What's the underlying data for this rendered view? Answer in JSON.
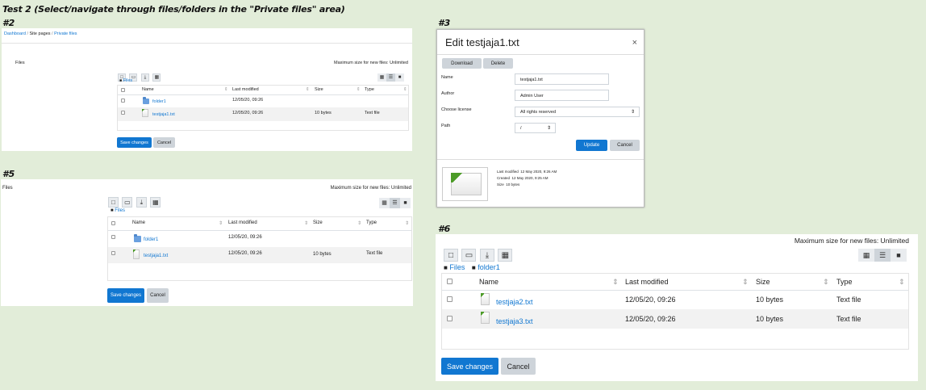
{
  "heading": "Test 2 (Select/navigate through files/folders in the \"Private files\" area)",
  "labels": {
    "s2": "#2",
    "s3": "#3",
    "s5": "#5",
    "s6": "#6"
  },
  "icons": {
    "new_file": "new-file-icon",
    "new_folder": "new-folder-icon",
    "download": "download-icon",
    "delete": "trash-icon",
    "view_icons": "grid-view-icon",
    "view_details": "list-view-icon",
    "view_tree": "tree-view-icon"
  },
  "colors": {
    "accent": "#1177d1",
    "background": "#e2edd9",
    "file_icon_green": "#4c9b27"
  },
  "s2": {
    "breadcrumb": {
      "dashboard": "Dashboard",
      "sep1": "/",
      "site_pages": "Site pages",
      "sep2": "/",
      "private_files": "Private files"
    },
    "files_label": "Files",
    "max_size": "Maximum size for new files: Unlimited",
    "path": {
      "root": "Files"
    },
    "columns": {
      "name": "Name",
      "modified": "Last modified",
      "size": "Size",
      "type": "Type"
    },
    "rows": [
      {
        "name": "folder1",
        "modified": "12/05/20, 09:26",
        "size": "",
        "type": ""
      },
      {
        "name": "testjaja1.txt",
        "modified": "12/05/20, 09:26",
        "size": "10 bytes",
        "type": "Text file"
      }
    ],
    "save": "Save changes",
    "cancel": "Cancel"
  },
  "s3": {
    "title": "Edit testjaja1.txt",
    "close": "×",
    "download": "Download",
    "delete": "Delete",
    "name_label": "Name",
    "name_value": "testjaja1.txt",
    "author_label": "Author",
    "author_value": "Admin User",
    "license_label": "Choose license",
    "license_value": "All rights reserved",
    "path_label": "Path",
    "path_value": "/",
    "update": "Update",
    "cancel": "Cancel",
    "info": {
      "last_modified_label": "Last modified",
      "last_modified": "12 May 2020, 9:26 AM",
      "created_label": "Created",
      "created": "12 May 2020, 9:25 AM",
      "size_label": "Size",
      "size": "10 bytes"
    }
  },
  "s5": {
    "files_label": "Files",
    "max_size": "Maximum size for new files: Unlimited",
    "path": {
      "root": "Files"
    },
    "columns": {
      "name": "Name",
      "modified": "Last modified",
      "size": "Size",
      "type": "Type"
    },
    "rows": [
      {
        "name": "folder1",
        "modified": "12/05/20, 09:26",
        "size": "",
        "type": ""
      },
      {
        "name": "testjaja1.txt",
        "modified": "12/05/20, 09:26",
        "size": "10 bytes",
        "type": "Text file"
      }
    ],
    "save": "Save changes",
    "cancel": "Cancel"
  },
  "s6": {
    "max_size": "Maximum size for new files: Unlimited",
    "path": {
      "root": "Files",
      "folder": "folder1"
    },
    "columns": {
      "name": "Name",
      "modified": "Last modified",
      "size": "Size",
      "type": "Type"
    },
    "rows": [
      {
        "name": "testjaja2.txt",
        "modified": "12/05/20, 09:26",
        "size": "10 bytes",
        "type": "Text file"
      },
      {
        "name": "testjaja3.txt",
        "modified": "12/05/20, 09:26",
        "size": "10 bytes",
        "type": "Text file"
      }
    ],
    "save": "Save changes",
    "cancel": "Cancel"
  }
}
